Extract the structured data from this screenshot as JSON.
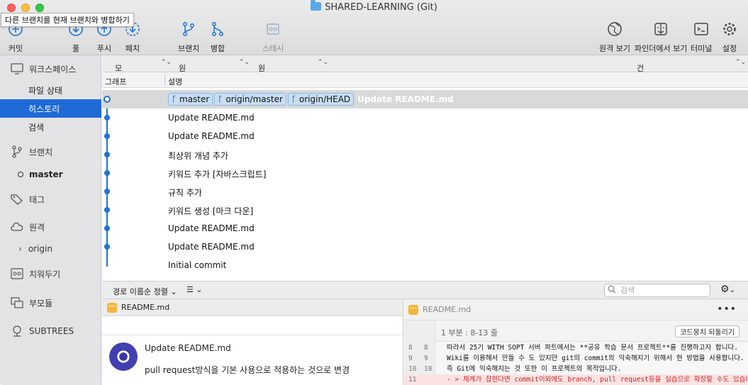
{
  "window": {
    "title": "SHARED-LEARNING (Git)",
    "tooltip": "다른 브랜치를 현재 브랜치와 병합하기"
  },
  "toolbar": {
    "commit": "커밋",
    "pull": "풀",
    "push": "푸시",
    "fetch": "페치",
    "branch": "브랜치",
    "merge": "병합",
    "stash": "스태시",
    "remote_view": "원격 보기",
    "show_in_finder": "파인더에서 보기",
    "terminal": "터미널",
    "settings": "설정"
  },
  "sidebar": {
    "workspace": "워크스페이스",
    "file_status": "파일 상태",
    "history": "히스토리",
    "search": "검색",
    "branches": "브랜치",
    "master": "master",
    "tags": "태그",
    "remotes": "원격",
    "origin": "origin",
    "stashes": "치워두기",
    "submodules": "부모듈",
    "subtrees": "SUBTREES"
  },
  "filters": {
    "all_branches": "모든 브랜치",
    "show_remote": "원격 브랜치 표시",
    "order": "원형 순",
    "jump_to": "건너뛰기:"
  },
  "columns": {
    "graph": "그래프",
    "description": "설명"
  },
  "commits": {
    "head": {
      "tags": [
        "master",
        "origin/master",
        "origin/HEAD"
      ],
      "message": "Update README.md"
    },
    "items": [
      "Update README.md",
      "Update README.md",
      "최상위 개념 추가",
      "키워드 추가 [자바스크립트]",
      "규칙 추가",
      "키워드 생성 [마크 다운]",
      "Update README.md",
      "Update README.md",
      "Initial commit"
    ]
  },
  "bottombar": {
    "sort": "경로 이름순 정렬",
    "search_placeholder": "검색"
  },
  "files": {
    "name": "README.md"
  },
  "commit_detail": {
    "title": "Update README.md",
    "body": "pull request방식을 기본 사용으로 적용하는 것으로 변경"
  },
  "diff": {
    "filename": "README.md",
    "hunk_label": "1 부분 : 8-13 줄",
    "revert_label": "코드뭉치 되돌리기",
    "lines": [
      {
        "old": "8",
        "new": "8",
        "text": "따라서 25기 WITH SOPT 서버 파트에서는 **공유 학습 문서 프로젝트**를 진행하고자 합니다.",
        "type": "context"
      },
      {
        "old": "9",
        "new": "9",
        "text": "Wiki를 이용해서 만들 수 도 있지만 git의 commit의 익숙해지기 위해서 현 방법을 사용합니다.",
        "type": "context"
      },
      {
        "old": "10",
        "new": "10",
        "text": "즉 Git에 익숙해지는 것 또한 이 프로젝트의 목적입니다.",
        "type": "context"
      },
      {
        "old": "11",
        "new": "",
        "text": "- > 체계가 잡힌다면 commit이외에도 branch, pull request등을 실습으로 확장할 수도 있습니다.",
        "type": "removed"
      }
    ]
  },
  "colors": {
    "accent": "#1e6ad6",
    "graph": "#1a74d6",
    "tag_bg": "#c8def5",
    "file_icon": "#f4b63b",
    "removed": "#d21f1f"
  }
}
